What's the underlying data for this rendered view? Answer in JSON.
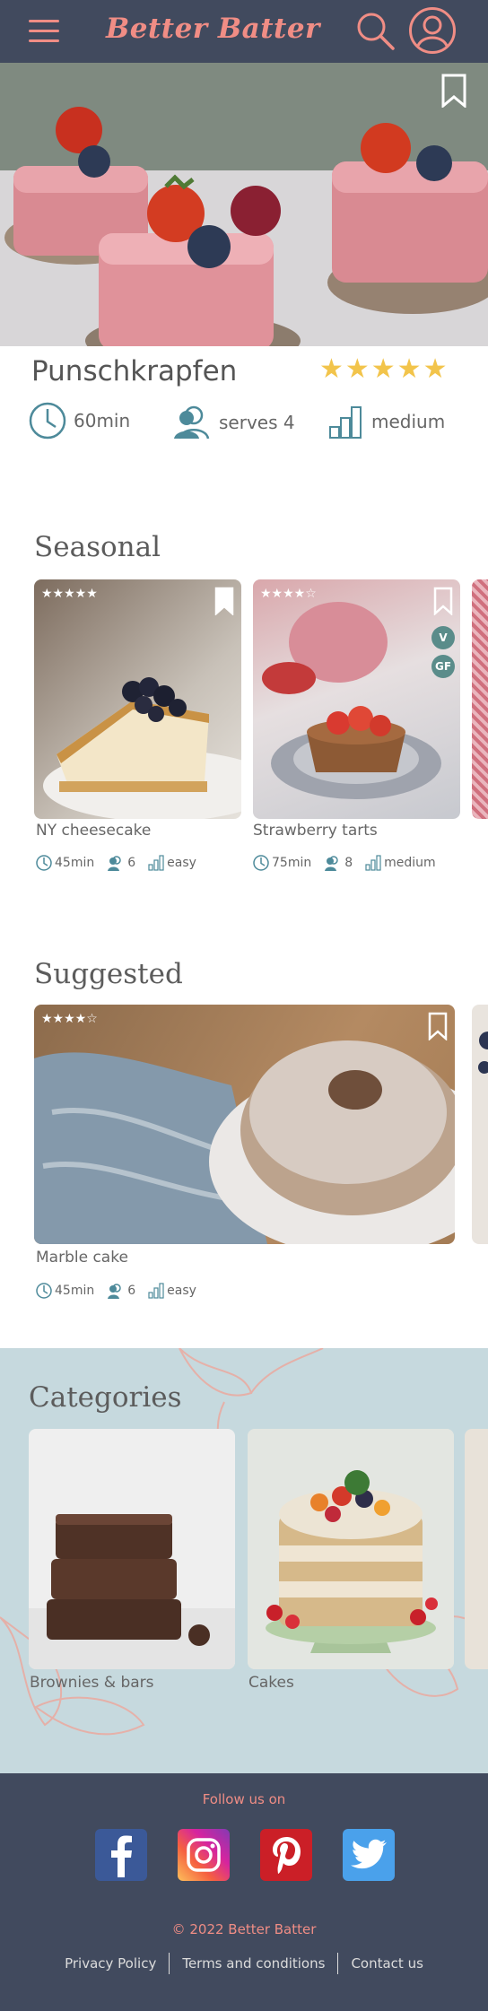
{
  "header": {
    "logo": "Better Batter",
    "icons": {
      "menu": "hamburger-menu-icon",
      "search": "search-icon",
      "profile": "user-profile-icon"
    },
    "accent_color": "#f08d85",
    "background_color": "#414a5e"
  },
  "recipe": {
    "title": "Punschkrapfen",
    "rating": 5,
    "rating_display": "★★★★★",
    "time": "60min",
    "serves": "serves 4",
    "difficulty": "medium"
  },
  "seasonal": {
    "title": "Seasonal",
    "cards": [
      {
        "name": "NY cheesecake",
        "stars": "★★★★★",
        "time": "45min",
        "serves": "6",
        "difficulty": "easy",
        "tags": []
      },
      {
        "name": "Strawberry  tarts",
        "stars": "★★★★☆",
        "time": "75min",
        "serves": "8",
        "difficulty": "medium",
        "tags": [
          "V",
          "GF"
        ]
      }
    ]
  },
  "suggested": {
    "title": "Suggested",
    "cards": [
      {
        "name": "Marble cake",
        "stars": "★★★★☆",
        "time": "45min",
        "serves": "6",
        "difficulty": "easy"
      }
    ]
  },
  "categories": {
    "title": "Categories",
    "items": [
      {
        "name": "Brownies & bars"
      },
      {
        "name": "Cakes"
      }
    ]
  },
  "footer": {
    "follow": "Follow us on",
    "social": [
      "facebook-icon",
      "instagram-icon",
      "pinterest-icon",
      "twitter-icon"
    ],
    "copyright": "© 2022 Better Batter",
    "links": [
      "Privacy Policy",
      "Terms and conditions",
      "Contact us"
    ]
  },
  "colors": {
    "star_gold": "#f2c44b",
    "teal_icon": "#4d8a9a",
    "tag_green": "#5a8c8a",
    "categories_bg": "#c6d9de"
  }
}
